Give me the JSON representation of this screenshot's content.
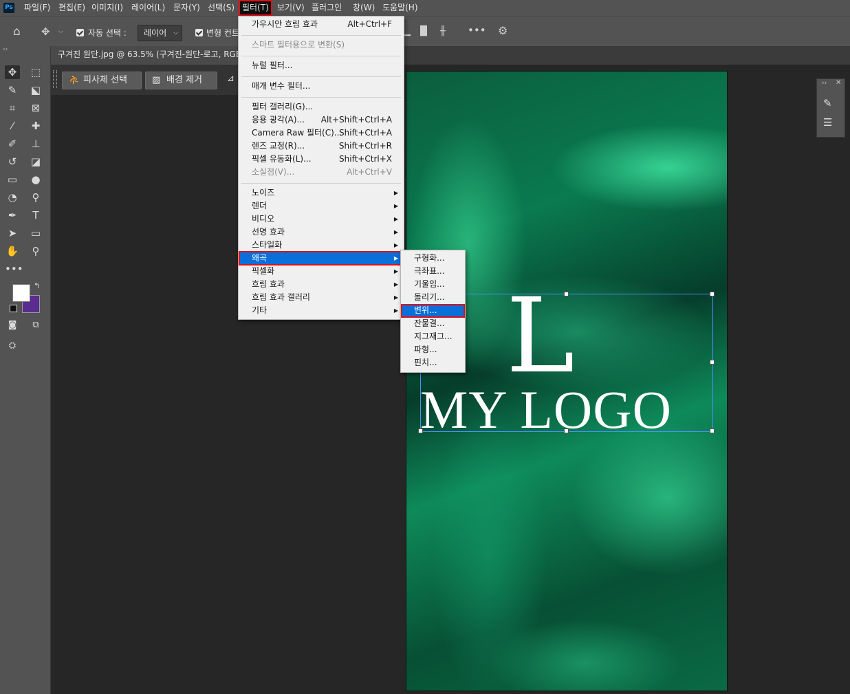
{
  "app": {
    "logo": "Ps"
  },
  "menubar": [
    "파일(F)",
    "편집(E)",
    "이미지(I)",
    "레이어(L)",
    "문자(Y)",
    "선택(S)",
    "필터(T)",
    "보기(V)",
    "플러그인",
    "창(W)",
    "도움말(H)"
  ],
  "options": {
    "auto_select_label": "자동 선택 :",
    "auto_select_value": "레이어",
    "transform_label": "변형 컨트"
  },
  "document": {
    "tab_title": "구겨진 원단.jpg @ 63.5% (구겨진-원단-로고, RGB",
    "subject_button": "피사체 선택",
    "remove_bg_button": "배경 제거"
  },
  "canvas": {
    "logo_letter": "L",
    "logo_text": "MY LOGO"
  },
  "colors": {
    "foreground": "#ffffff",
    "background": "#5b2c8f",
    "highlight": "#0a6fd8",
    "callout": "#e0101a"
  },
  "filter_menu": {
    "group1": [
      {
        "label": "가우시안 흐림 효과",
        "shortcut": "Alt+Ctrl+F"
      }
    ],
    "group2": [
      {
        "label": "스마트 필터용으로 변환(S)",
        "disabled": true
      }
    ],
    "group3": [
      {
        "label": "뉴럴 필터..."
      }
    ],
    "group4": [
      {
        "label": "매개 변수 필터..."
      }
    ],
    "group5": [
      {
        "label": "필터 갤러리(G)..."
      },
      {
        "label": "응용 광각(A)...",
        "shortcut": "Alt+Shift+Ctrl+A"
      },
      {
        "label": "Camera Raw 필터(C)...",
        "shortcut": "Shift+Ctrl+A"
      },
      {
        "label": "렌즈 교정(R)...",
        "shortcut": "Shift+Ctrl+R"
      },
      {
        "label": "픽셀 유동화(L)...",
        "shortcut": "Shift+Ctrl+X"
      },
      {
        "label": "소실점(V)...",
        "shortcut": "Alt+Ctrl+V",
        "disabled": true
      }
    ],
    "group6": [
      {
        "label": "노이즈"
      },
      {
        "label": "렌더"
      },
      {
        "label": "비디오"
      },
      {
        "label": "선명 효과"
      },
      {
        "label": "스타일화"
      },
      {
        "label": "왜곡",
        "highlighted": true
      },
      {
        "label": "픽셀화"
      },
      {
        "label": "흐림 효과"
      },
      {
        "label": "흐림 효과 갤러리"
      },
      {
        "label": "기타"
      }
    ]
  },
  "distort_submenu": [
    "구형화...",
    "극좌표...",
    "기울임...",
    "돌리기...",
    "변위...",
    "잔물결...",
    "지그재그...",
    "파형...",
    "핀치..."
  ],
  "distort_highlighted_index": 4
}
